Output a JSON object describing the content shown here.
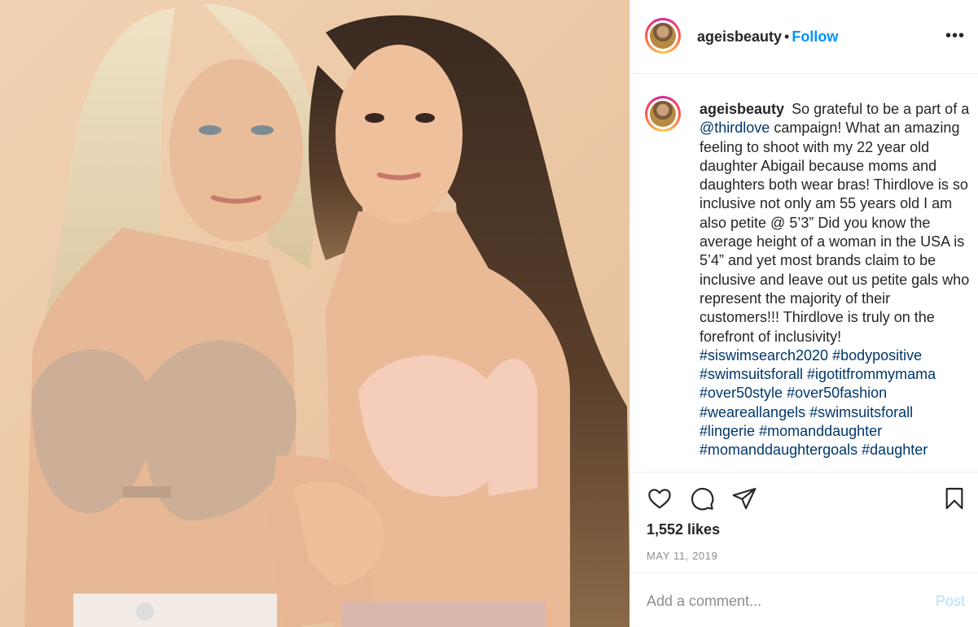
{
  "header": {
    "username": "ageisbeauty",
    "separator": "•",
    "follow_label": "Follow",
    "more_label": "•••"
  },
  "caption": {
    "username": "ageisbeauty",
    "text_before_mention": "So grateful to be a part of a",
    "mention": "@thirdlove",
    "text_after_mention": "campaign! What an amazing feeling to shoot with my 22 year old daughter Abigail because moms and daughters both wear bras! Thirdlove is so inclusive not only am 55 years old I am also petite @ 5’3” Did you know the average height of a woman in the USA is 5’4” and yet most brands claim to be inclusive and leave out us petite gals who represent the majority of their customers!!! Thirdlove is truly on the forefront of inclusivity!",
    "hashtags": [
      "#siswimsearch2020",
      "#bodypositive",
      "#swimsuitsforall",
      "#igotitfrommymama",
      "#over50style",
      "#over50fashion",
      "#weareallangels",
      "#swimsuitsforall",
      "#lingerie",
      "#momanddaughter",
      "#momanddaughtergoals",
      "#daughter"
    ]
  },
  "actions": {
    "likes": "1,552 likes",
    "date": "MAY 11, 2019",
    "icons": [
      "heart-icon",
      "comment-icon",
      "share-icon",
      "bookmark-icon"
    ]
  },
  "composer": {
    "placeholder": "Add a comment...",
    "post_label": "Post"
  },
  "colors": {
    "link": "#00376b",
    "follow": "#0095f6",
    "muted": "#8e8e8e",
    "photo_bg": "#ecc9a6"
  }
}
